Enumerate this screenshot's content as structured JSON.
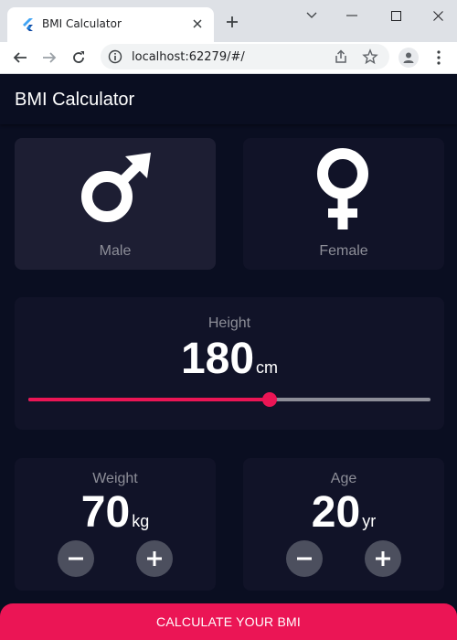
{
  "browser": {
    "tab_title": "BMI Calculator",
    "url": "localhost:62279/#/"
  },
  "app": {
    "title": "BMI Calculator",
    "gender": {
      "male_label": "Male",
      "female_label": "Female",
      "selected": "male"
    },
    "height": {
      "label": "Height",
      "value": "180",
      "unit": "cm",
      "slider_fraction": 0.6
    },
    "weight": {
      "label": "Weight",
      "value": "70",
      "unit": "kg"
    },
    "age": {
      "label": "Age",
      "value": "20",
      "unit": "yr"
    },
    "calculate_label": "CALCULATE YOUR BMI"
  },
  "colors": {
    "background": "#0a0e21",
    "card_active": "#1d1e33",
    "card_inactive": "#111328",
    "accent": "#eb1555",
    "label_gray": "#8d8e98",
    "round_button": "#4c4f5e"
  },
  "icons": {
    "male": "mars-icon",
    "female": "venus-icon",
    "minus": "minus-icon",
    "plus": "plus-icon"
  }
}
